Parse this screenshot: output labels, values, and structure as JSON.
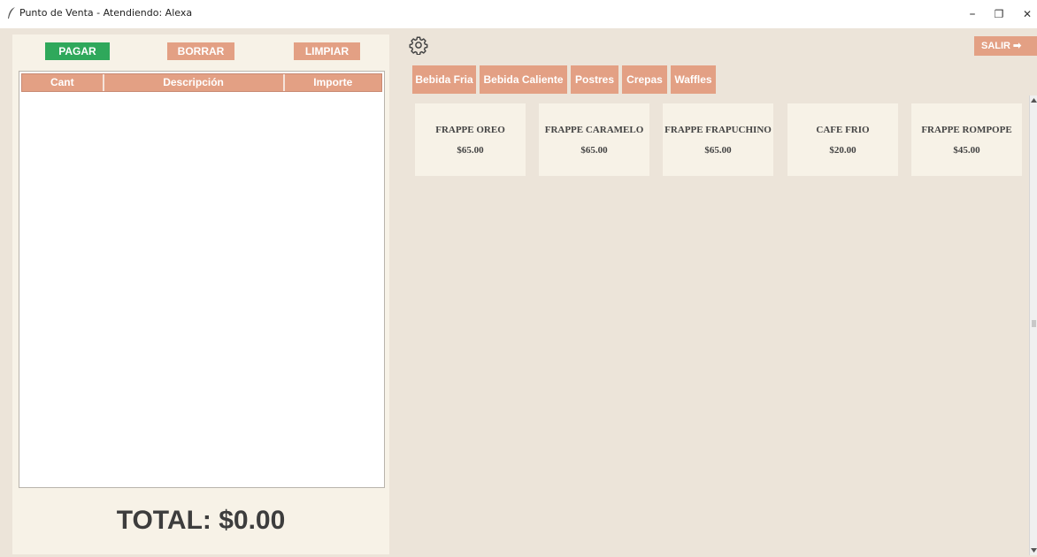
{
  "window": {
    "title": "Punto de Venta - Atendiendo: Alexa",
    "minimize_glyph": "–",
    "restore_glyph": "❐",
    "close_glyph": "✕",
    "app_icon": "feather-icon"
  },
  "actions": {
    "pagar_label": "PAGAR",
    "borrar_label": "BORRAR",
    "limpiar_label": "LIMPIAR"
  },
  "ticket_table": {
    "columns": [
      "Cant",
      "Descripción",
      "Importe"
    ],
    "rows": []
  },
  "total_label": "TOTAL: $0.00",
  "settings_icon": "gear-icon",
  "salir_label": "SALIR ➡",
  "categories": [
    "Bebida Fria",
    "Bebida Caliente",
    "Postres",
    "Crepas",
    "Waffles"
  ],
  "products": [
    {
      "name": "FRAPPE OREO",
      "price": "$65.00"
    },
    {
      "name": "FRAPPE CARAMELO",
      "price": "$65.00"
    },
    {
      "name": "FRAPPE FRAPUCHINO",
      "price": "$65.00"
    },
    {
      "name": "CAFE FRIO",
      "price": "$20.00"
    },
    {
      "name": "FRAPPE ROMPOPE",
      "price": "$45.00"
    }
  ],
  "colors": {
    "accent": "#e3a084",
    "pay": "#2fa85b",
    "panel": "#f7f2e7",
    "background": "#ece4d9"
  }
}
